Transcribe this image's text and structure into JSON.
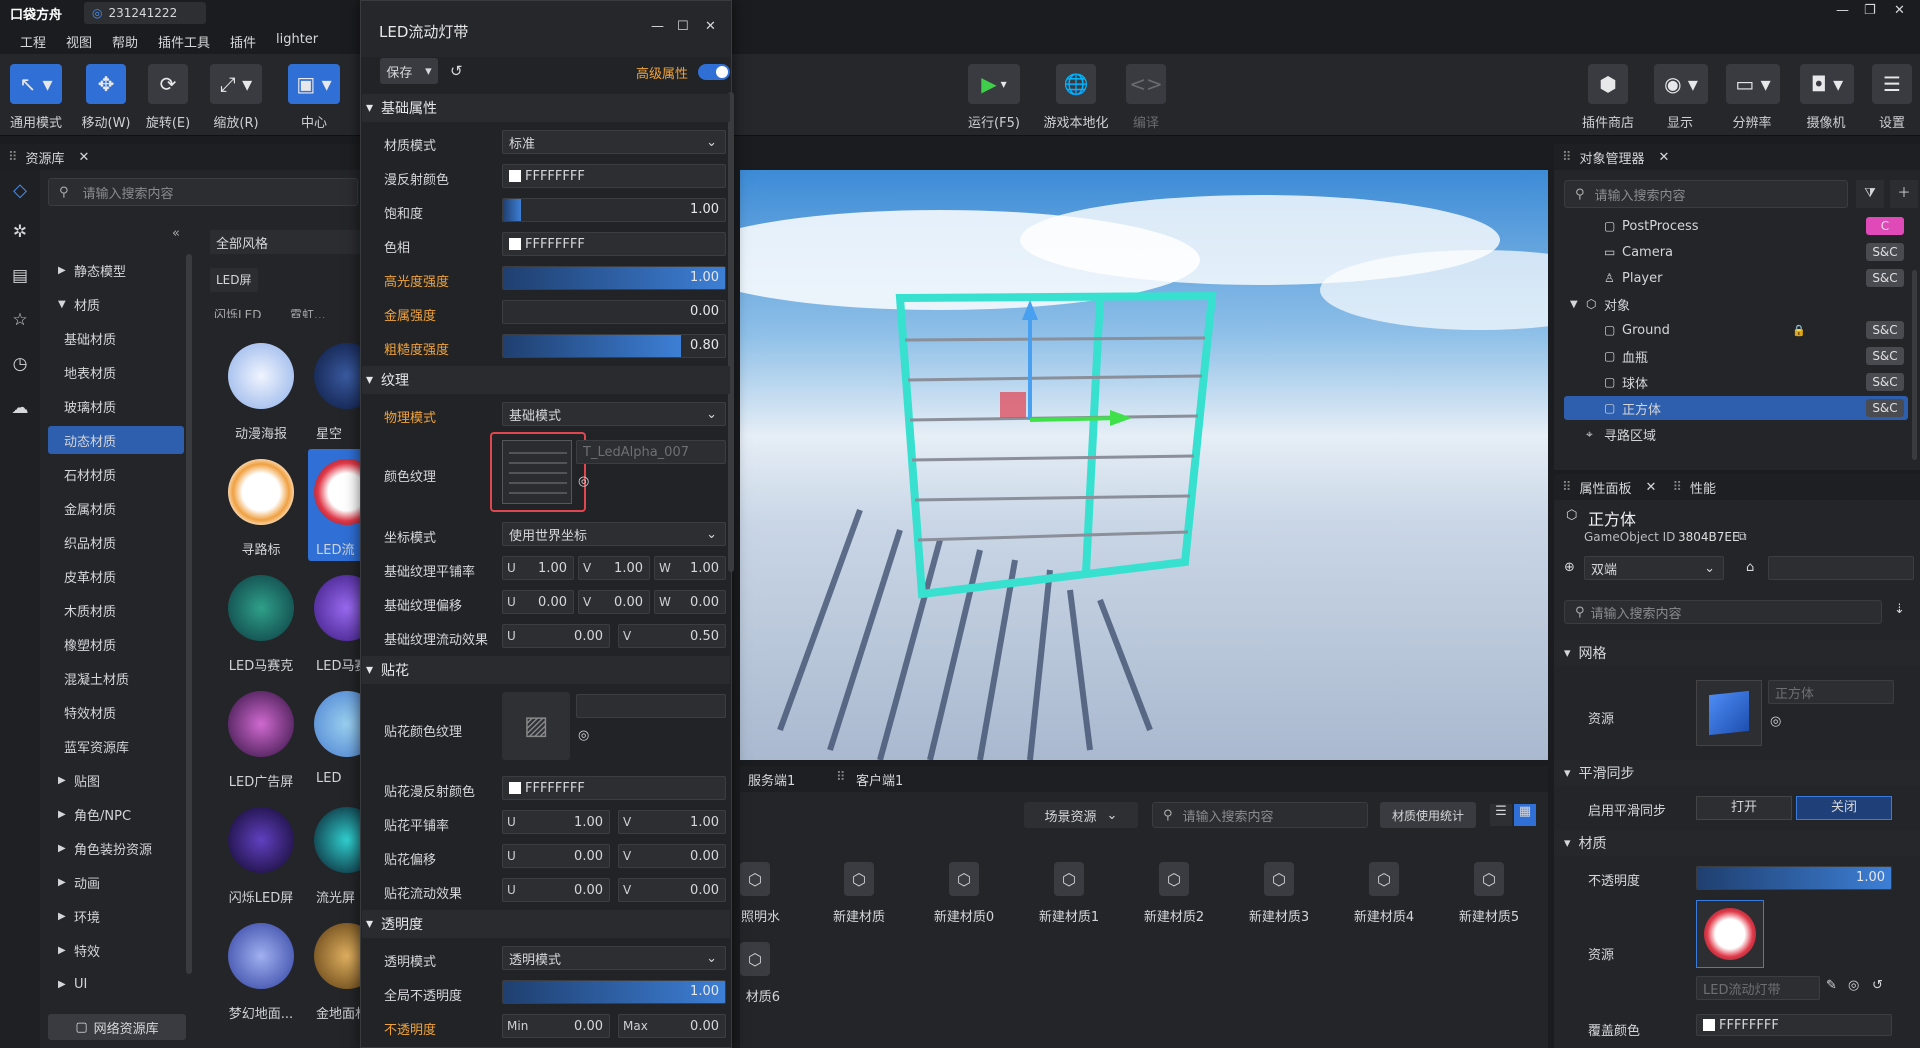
{
  "app": {
    "logo": "口袋方舟",
    "tab_id": "231241222"
  },
  "menu": [
    "工程",
    "视图",
    "帮助",
    "插件工具",
    "插件",
    "lighter"
  ],
  "toolbar": {
    "left": [
      {
        "label": "通用模式",
        "icon": "select-icon"
      },
      {
        "label": "移动(W)",
        "icon": "move-icon"
      },
      {
        "label": "旋转(E)",
        "icon": "rotate-icon"
      },
      {
        "label": "缩放(R)",
        "icon": "scale-icon"
      },
      {
        "label": "中心",
        "icon": "pivot-icon"
      }
    ],
    "center": [
      {
        "label": "运行(F5)",
        "icon": "play-icon"
      },
      {
        "label": "游戏本地化",
        "icon": "globe-icon"
      },
      {
        "label": "编译",
        "icon": "code-icon"
      }
    ],
    "right": [
      {
        "label": "插件商店",
        "icon": "plugin-store-icon"
      },
      {
        "label": "显示",
        "icon": "eye-icon"
      },
      {
        "label": "分辨率",
        "icon": "monitor-icon"
      },
      {
        "label": "摄像机",
        "icon": "camera-icon"
      },
      {
        "label": "设置",
        "icon": "settings-icon"
      }
    ]
  },
  "assets": {
    "tab": "资源库",
    "search_placeholder": "请输入搜索内容",
    "style_filter": "全部风格",
    "tag": "LED屏",
    "tree": [
      {
        "label": "静态模型",
        "arrow": "▶",
        "indent": 0
      },
      {
        "label": "材质",
        "arrow": "▼",
        "indent": 0
      },
      {
        "label": "基础材质",
        "indent": 1
      },
      {
        "label": "地表材质",
        "indent": 1
      },
      {
        "label": "玻璃材质",
        "indent": 1
      },
      {
        "label": "动态材质",
        "indent": 1,
        "selected": true
      },
      {
        "label": "石材材质",
        "indent": 1
      },
      {
        "label": "金属材质",
        "indent": 1
      },
      {
        "label": "织品材质",
        "indent": 1
      },
      {
        "label": "皮革材质",
        "indent": 1
      },
      {
        "label": "木质材质",
        "indent": 1
      },
      {
        "label": "橡塑材质",
        "indent": 1
      },
      {
        "label": "混凝土材质",
        "indent": 1
      },
      {
        "label": "特效材质",
        "indent": 1
      },
      {
        "label": "蓝军资源库",
        "indent": 1
      },
      {
        "label": "贴图",
        "arrow": "▶",
        "indent": 0
      },
      {
        "label": "角色/NPC",
        "arrow": "▶",
        "indent": 0
      },
      {
        "label": "角色装扮资源",
        "arrow": "▶",
        "indent": 0
      },
      {
        "label": "动画",
        "arrow": "▶",
        "indent": 0
      },
      {
        "label": "环境",
        "arrow": "▶",
        "indent": 0
      },
      {
        "label": "特效",
        "arrow": "▶",
        "indent": 0
      },
      {
        "label": "UI",
        "arrow": "▶",
        "indent": 0
      }
    ],
    "grid_top_labels": [
      "闪烁LED",
      "霓虹..."
    ],
    "grid": [
      [
        "动漫海报",
        "星空"
      ],
      [
        "寻路标",
        "LED流"
      ],
      [
        "LED马赛克",
        "LED马赛"
      ],
      [
        "LED广告屏",
        "LED"
      ],
      [
        "闪烁LED屏",
        "流光屏"
      ],
      [
        "梦幻地面...",
        "金地面材"
      ]
    ],
    "net_button": "网络资源库"
  },
  "material_editor": {
    "title": "LED流动灯带",
    "save": "保存",
    "advanced": "高级属性",
    "basic": {
      "header": "基础属性",
      "mode_label": "材质模式",
      "mode_value": "标准",
      "diffuse_label": "漫反射颜色",
      "diffuse_value": "FFFFFFFF",
      "saturation_label": "饱和度",
      "saturation_value": "1.00",
      "saturation_level": 0.08,
      "hue_label": "色相",
      "hue_value": "FFFFFFFF",
      "specular_label": "高光度强度",
      "specular_value": "1.00",
      "specular_level": 1.0,
      "metal_label": "金属强度",
      "metal_value": "0.00",
      "metal_level": 0.0,
      "rough_label": "粗糙度强度",
      "rough_value": "0.80",
      "rough_level": 0.8
    },
    "texture": {
      "header": "纹理",
      "phys_label": "物理模式",
      "phys_value": "基础模式",
      "color_tex_label": "颜色纹理",
      "color_tex_value": "T_LedAlpha_007",
      "coord_label": "坐标模式",
      "coord_value": "使用世界坐标",
      "tiling_label": "基础纹理平铺率",
      "tiling": {
        "U": "1.00",
        "V": "1.00",
        "W": "1.00"
      },
      "offset_label": "基础纹理偏移",
      "offset": {
        "U": "0.00",
        "V": "0.00",
        "W": "0.00"
      },
      "flow_label": "基础纹理流动效果",
      "flow": {
        "U": "0.00",
        "V": "0.50"
      }
    },
    "decal": {
      "header": "贴花",
      "color_tex_label": "贴花颜色纹理",
      "diffuse_label": "贴花漫反射颜色",
      "diffuse_value": "FFFFFFFF",
      "tiling_label": "贴花平铺率",
      "tiling": {
        "U": "1.00",
        "V": "1.00"
      },
      "offset_label": "贴花偏移",
      "offset": {
        "U": "0.00",
        "V": "0.00"
      },
      "flow_label": "贴花流动效果",
      "flow": {
        "U": "0.00",
        "V": "0.00"
      }
    },
    "opacity": {
      "header": "透明度",
      "mode_label": "透明模式",
      "mode_value": "透明模式",
      "global_label": "全局不透明度",
      "global_value": "1.00",
      "global_level": 1.0,
      "op_label": "不透明度",
      "min_label": "Min",
      "min_value": "0.00",
      "max_label": "Max",
      "max_value": "0.00"
    }
  },
  "bottom": {
    "tabs": [
      "服务端1",
      "客户端1"
    ],
    "scene_select": "场景资源",
    "search_placeholder": "请输入搜索内容",
    "stats_button": "材质使用统计",
    "items": [
      "照明水",
      "新建材质",
      "新建材质0",
      "新建材质1",
      "新建材质2",
      "新建材质3",
      "新建材质4",
      "新建材质5",
      "材质6"
    ]
  },
  "objects": {
    "tab": "对象管理器",
    "search_placeholder": "请输入搜索内容",
    "rows": [
      {
        "label": "PostProcess",
        "badge": "C",
        "indent": 1,
        "icon": "postprocess-icon"
      },
      {
        "label": "Camera",
        "badge": "S&C",
        "indent": 1,
        "icon": "camera-small-icon"
      },
      {
        "label": "Player",
        "badge": "S&C",
        "indent": 1,
        "icon": "player-icon"
      },
      {
        "label": "对象",
        "badge": "",
        "indent": 0,
        "arrow": "▼",
        "icon": "cube-icon"
      },
      {
        "label": "Ground",
        "badge": "S&C",
        "indent": 1,
        "icon": "mesh-icon",
        "lock": true
      },
      {
        "label": "血瓶",
        "badge": "S&C",
        "indent": 1,
        "icon": "mesh-icon"
      },
      {
        "label": "球体",
        "badge": "S&C",
        "indent": 1,
        "icon": "mesh-icon"
      },
      {
        "label": "正方体",
        "badge": "S&C",
        "indent": 1,
        "icon": "mesh-icon",
        "selected": true
      },
      {
        "label": "寻路区域",
        "badge": "",
        "indent": 0,
        "icon": "nav-icon"
      }
    ]
  },
  "props": {
    "tab": "属性面板",
    "tab2": "性能",
    "name": "正方体",
    "gameobject_label": "GameObject ID",
    "gameobject_id": "3804B7EE",
    "net_value": "双端",
    "search_placeholder": "请输入搜索内容",
    "mesh_header": "网格",
    "resource_label": "资源",
    "mesh_name": "正方体",
    "smooth_header": "平滑同步",
    "smooth_label": "启用平滑同步",
    "on": "打开",
    "off": "关闭",
    "material_header": "材质",
    "opacity_label": "不透明度",
    "opacity_value": "1.00",
    "opacity_level": 1.0,
    "mat_resource_label": "资源",
    "mat_name": "LED流动灯带",
    "cover_label": "覆盖颜色",
    "cover_value": "FFFFFFFF"
  }
}
